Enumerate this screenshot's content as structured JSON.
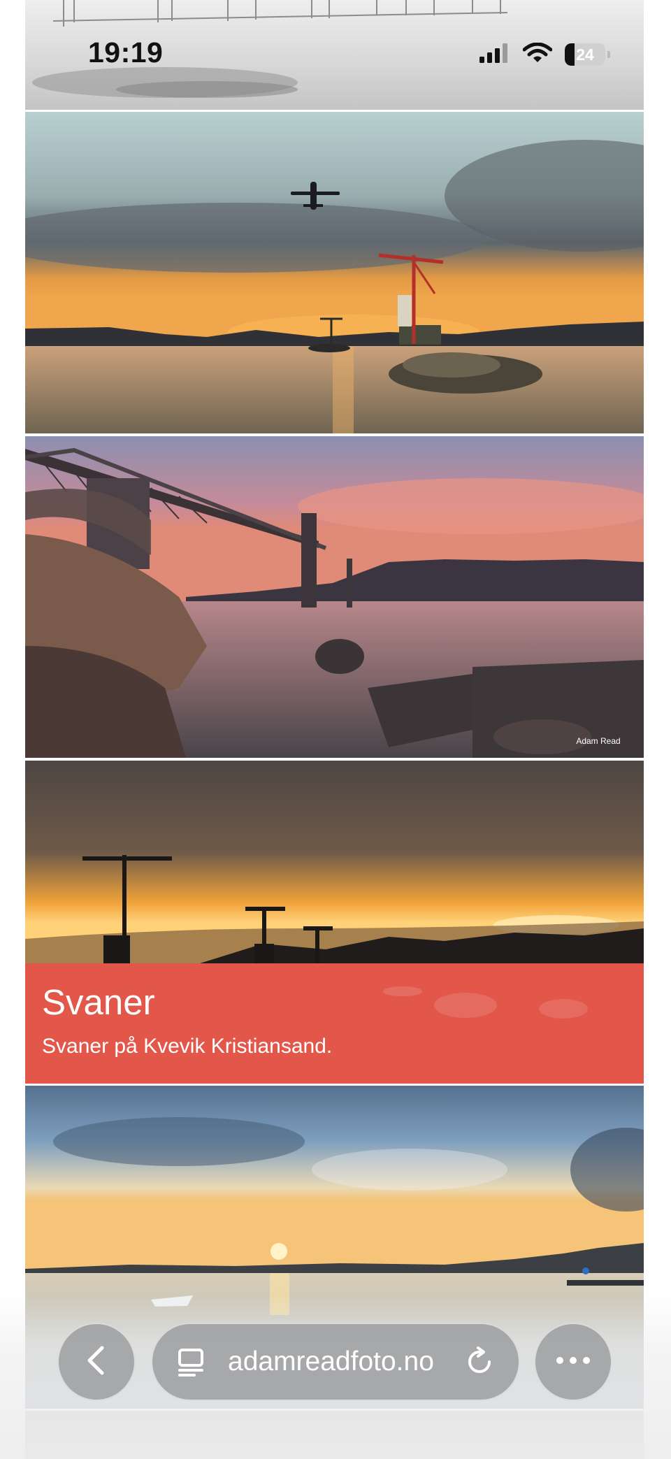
{
  "status_bar": {
    "time": "19:19",
    "battery_level": "24",
    "battery_fraction": 0.24,
    "icons": [
      "cellular-signal-icon",
      "wifi-icon",
      "battery-icon"
    ]
  },
  "gallery": {
    "images": [
      {
        "name": "foggy-pier",
        "description_hidden": true
      },
      {
        "name": "sunset-airplane-beacon"
      },
      {
        "name": "bridge-rocks-sunset",
        "watermark": "Adam Read"
      },
      {
        "name": "svaner-sunset-beacons"
      },
      {
        "name": "calm-water-sunset-boat"
      }
    ],
    "caption": {
      "title": "Svaner",
      "subtitle": "Svaner på Kvevik Kristiansand.",
      "background_color": "#e2574a"
    }
  },
  "browser": {
    "url": "adamreadfoto.no",
    "back_icon": "chevron-left-icon",
    "reader_icon": "page-menu-icon",
    "reload_icon": "reload-icon",
    "more_icon": "more-dots-icon"
  }
}
